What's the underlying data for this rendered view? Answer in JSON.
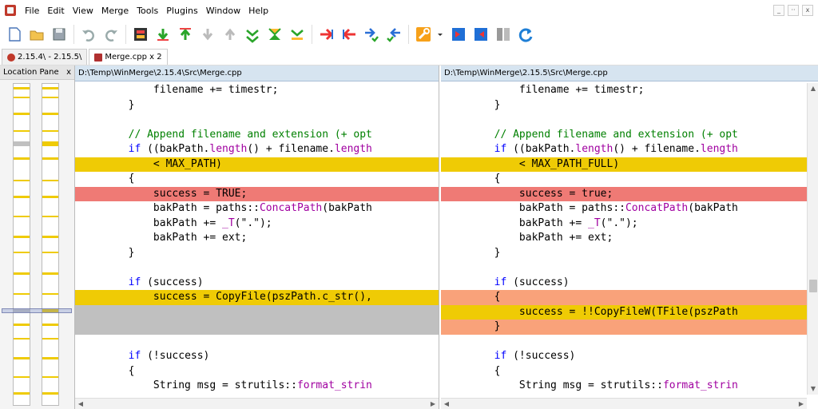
{
  "menu": {
    "items": [
      "File",
      "Edit",
      "View",
      "Merge",
      "Tools",
      "Plugins",
      "Window",
      "Help"
    ],
    "controls": [
      "_",
      "··",
      "x"
    ]
  },
  "tabs": [
    {
      "label": "2.15.4\\ - 2.15.5\\"
    },
    {
      "label": "Merge.cpp x 2"
    }
  ],
  "location_pane": {
    "title": "Location Pane",
    "close": "x"
  },
  "left": {
    "path": "D:\\Temp\\WinMerge\\2.15.4\\Src\\Merge.cpp"
  },
  "right": {
    "path": "D:\\Temp\\WinMerge\\2.15.5\\Src\\Merge.cpp"
  },
  "code_left": [
    {
      "t": "            filename += timestr;",
      "cls": ""
    },
    {
      "t": "        }",
      "cls": ""
    },
    {
      "t": "",
      "cls": ""
    },
    {
      "t": "        // Append filename and extension (+ opt",
      "cls": "",
      "cm": true
    },
    {
      "t": "        if ((bakPath.length() + filename.length",
      "cls": "",
      "kw": "if"
    },
    {
      "t": "            < MAX_PATH)",
      "cls": "diff"
    },
    {
      "t": "        {",
      "cls": ""
    },
    {
      "t": "            success = TRUE;",
      "cls": "sel"
    },
    {
      "t": "            bakPath = paths::ConcatPath(bakPath",
      "cls": "",
      "fn": "ConcatPath"
    },
    {
      "t": "            bakPath += _T(\".\");",
      "cls": ""
    },
    {
      "t": "            bakPath += ext;",
      "cls": ""
    },
    {
      "t": "        }",
      "cls": ""
    },
    {
      "t": "",
      "cls": ""
    },
    {
      "t": "        if (success)",
      "cls": "",
      "kw": "if"
    },
    {
      "t": "            success = CopyFile(pszPath.c_str(),",
      "cls": "diff"
    },
    {
      "t": "",
      "cls": "missing"
    },
    {
      "t": "",
      "cls": "missing"
    },
    {
      "t": "",
      "cls": ""
    },
    {
      "t": "        if (!success)",
      "cls": "",
      "kw": "if"
    },
    {
      "t": "        {",
      "cls": ""
    },
    {
      "t": "            String msg = strutils::format_strin",
      "cls": "",
      "fn": "format_strin"
    }
  ],
  "code_right": [
    {
      "t": "            filename += timestr;",
      "cls": ""
    },
    {
      "t": "        }",
      "cls": ""
    },
    {
      "t": "",
      "cls": ""
    },
    {
      "t": "        // Append filename and extension (+ opt",
      "cls": "",
      "cm": true
    },
    {
      "t": "        if ((bakPath.length() + filename.length",
      "cls": "",
      "kw": "if"
    },
    {
      "t": "            < MAX_PATH_FULL)",
      "cls": "diff"
    },
    {
      "t": "        {",
      "cls": ""
    },
    {
      "t": "            success = true;",
      "cls": "sel"
    },
    {
      "t": "            bakPath = paths::ConcatPath(bakPath",
      "cls": "",
      "fn": "ConcatPath"
    },
    {
      "t": "            bakPath += _T(\".\");",
      "cls": ""
    },
    {
      "t": "            bakPath += ext;",
      "cls": ""
    },
    {
      "t": "        }",
      "cls": ""
    },
    {
      "t": "",
      "cls": ""
    },
    {
      "t": "        if (success)",
      "cls": "",
      "kw": "if"
    },
    {
      "t": "        {",
      "cls": "diff-salmon"
    },
    {
      "t": "            success = !!CopyFileW(TFile(pszPath",
      "cls": "diff"
    },
    {
      "t": "        }",
      "cls": "diff-salmon"
    },
    {
      "t": "",
      "cls": ""
    },
    {
      "t": "        if (!success)",
      "cls": "",
      "kw": "if"
    },
    {
      "t": "        {",
      "cls": ""
    },
    {
      "t": "            String msg = strutils::format_strin",
      "cls": "",
      "fn": "format_strin"
    }
  ],
  "colors": {
    "diff": "#efcb05",
    "selected_diff": "#ef7a75",
    "missing": "#c0c0c0",
    "header_bg": "#d6e4f0"
  }
}
